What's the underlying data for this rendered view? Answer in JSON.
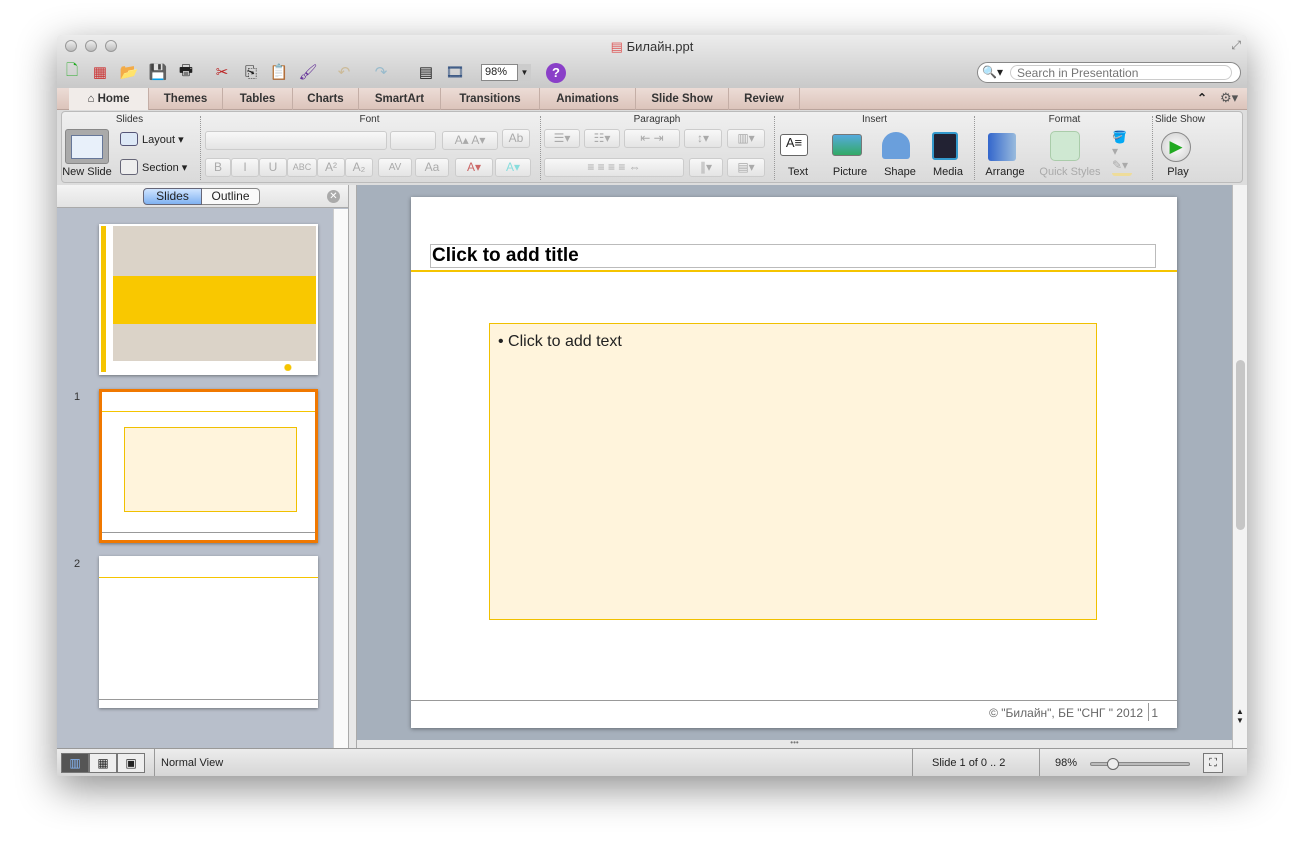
{
  "window": {
    "title": "Билайн.ppt"
  },
  "toolbar": {
    "zoom": "98%",
    "search_placeholder": "Search in Presentation",
    "icons": [
      "new-icon",
      "gallery-icon",
      "open-icon",
      "save-icon",
      "print-icon",
      "cut-icon",
      "copy-icon",
      "paste-icon",
      "format-painter-icon",
      "undo-icon",
      "redo-icon",
      "slide-sorter-icon",
      "media-browser-icon",
      "help-icon"
    ]
  },
  "tabs": [
    {
      "label": "Home",
      "active": true
    },
    {
      "label": "Themes"
    },
    {
      "label": "Tables"
    },
    {
      "label": "Charts"
    },
    {
      "label": "SmartArt"
    },
    {
      "label": "Transitions"
    },
    {
      "label": "Animations"
    },
    {
      "label": "Slide Show"
    },
    {
      "label": "Review"
    }
  ],
  "ribbon": {
    "groups": {
      "slides": "Slides",
      "font": "Font",
      "paragraph": "Paragraph",
      "insert": "Insert",
      "format": "Format",
      "slideshow": "Slide Show"
    },
    "new_slide": "New Slide",
    "layout": "Layout",
    "section": "Section",
    "font_buttons": [
      "B",
      "I",
      "U",
      "ABC",
      "A²",
      "A₂",
      "AV",
      "Aa"
    ],
    "insert": [
      "Text",
      "Picture",
      "Shape",
      "Media"
    ],
    "arrange": "Arrange",
    "quick_styles": "Quick Styles",
    "play": "Play"
  },
  "panel": {
    "tabs": [
      "Slides",
      "Outline"
    ],
    "active_tab": "Slides",
    "slides": [
      {
        "number": ""
      },
      {
        "number": "1",
        "selected": true
      },
      {
        "number": "2"
      }
    ]
  },
  "slide": {
    "title_placeholder": "Click to add title",
    "body_placeholder": "• Click to add text",
    "footer": "© \"Билайн\", БЕ \"СНГ \" 2012",
    "page": "1"
  },
  "status": {
    "view": "Normal View",
    "slide_info": "Slide 1 of 0 .. 2",
    "zoom": "98%",
    "zoom_level": 0.3
  },
  "colors": {
    "accent": "#f5c400",
    "selection": "#f07800",
    "tab_bar": "#e6d3cc"
  }
}
